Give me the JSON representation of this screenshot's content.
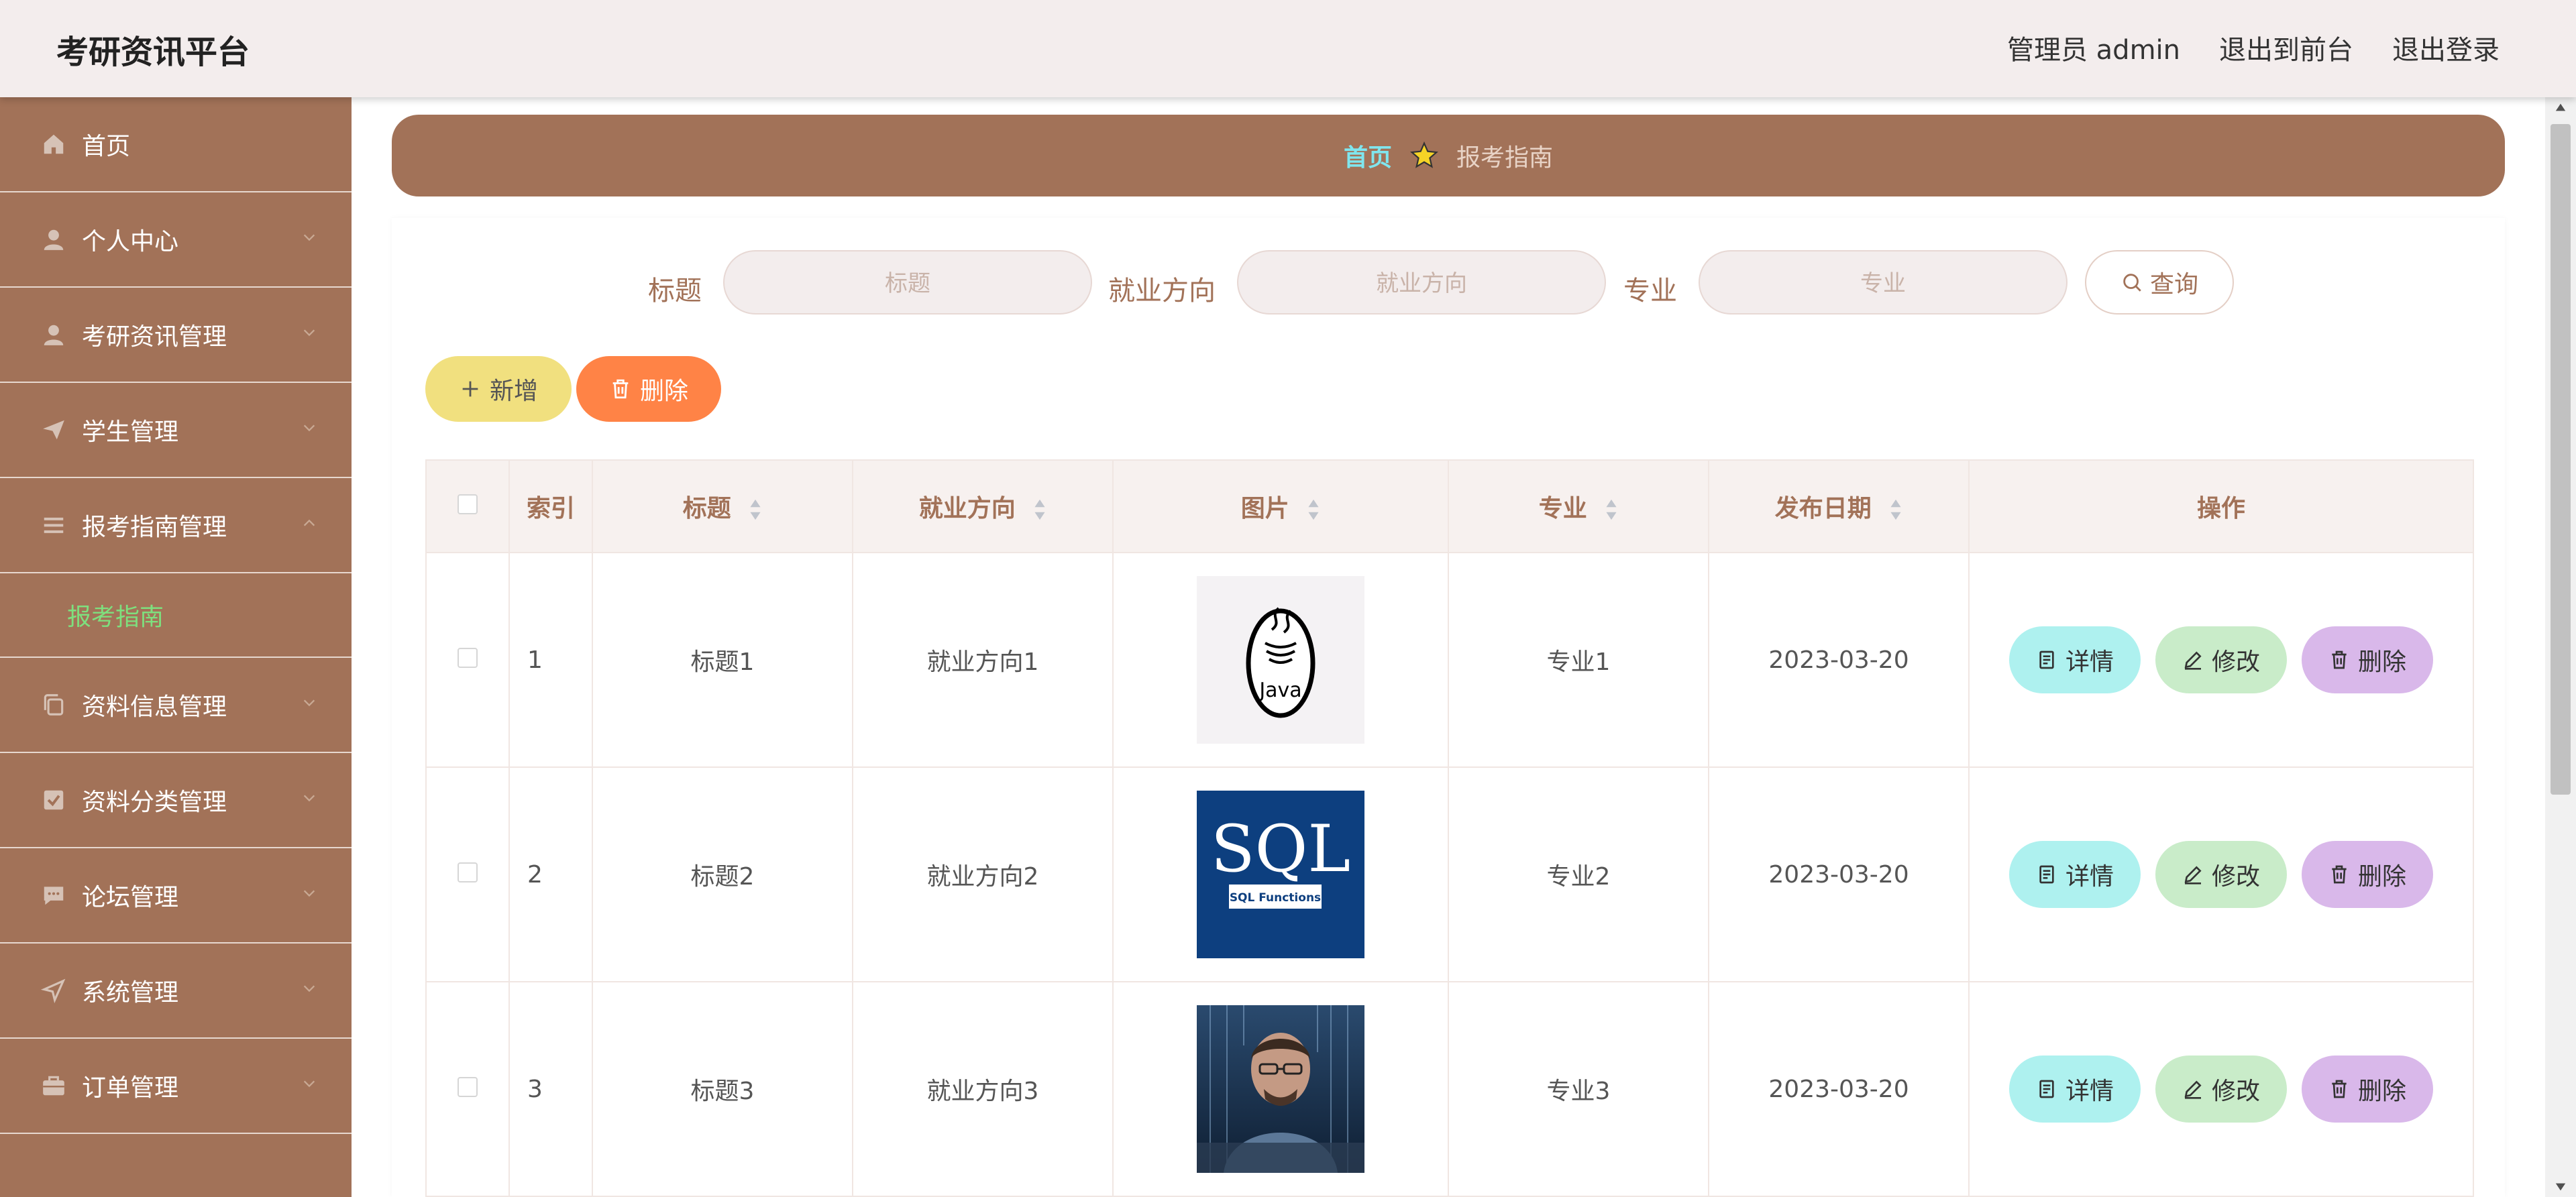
{
  "app": {
    "title": "考研资讯平台"
  },
  "header": {
    "user_label": "管理员 admin",
    "to_front": "退出到前台",
    "logout": "退出登录"
  },
  "sidebar": {
    "items": [
      {
        "label": "首页",
        "icon": "home-icon"
      },
      {
        "label": "个人中心",
        "icon": "user-icon"
      },
      {
        "label": "考研资讯管理",
        "icon": "user-icon"
      },
      {
        "label": "学生管理",
        "icon": "send-icon"
      },
      {
        "label": "报考指南管理",
        "icon": "menu-icon",
        "expanded": true
      },
      {
        "label": "资料信息管理",
        "icon": "copy-icon"
      },
      {
        "label": "资料分类管理",
        "icon": "checkbox-icon"
      },
      {
        "label": "论坛管理",
        "icon": "chat-icon"
      },
      {
        "label": "系统管理",
        "icon": "navigation-icon"
      },
      {
        "label": "订单管理",
        "icon": "briefcase-icon"
      }
    ],
    "sub_item": "报考指南"
  },
  "breadcrumb": {
    "home": "首页",
    "current": "报考指南"
  },
  "search": {
    "title_label": "标题",
    "title_placeholder": "标题",
    "direction_label": "就业方向",
    "direction_placeholder": "就业方向",
    "major_label": "专业",
    "major_placeholder": "专业",
    "query_button": "查询"
  },
  "actions": {
    "add": "新增",
    "delete": "删除"
  },
  "table": {
    "headers": [
      "索引",
      "标题",
      "就业方向",
      "图片",
      "专业",
      "发布日期",
      "操作"
    ],
    "rows": [
      {
        "index": "1",
        "title": "标题1",
        "direction": "就业方向1",
        "image": "java-logo",
        "major": "专业1",
        "date": "2023-03-20"
      },
      {
        "index": "2",
        "title": "标题2",
        "direction": "就业方向2",
        "image": "sql-functions-cover",
        "major": "专业2",
        "date": "2023-03-20"
      },
      {
        "index": "3",
        "title": "标题3",
        "direction": "就业方向3",
        "image": "programmer-photo",
        "major": "专业3",
        "date": "2023-03-20"
      }
    ],
    "row_actions": {
      "detail": "详情",
      "edit": "修改",
      "remove": "删除"
    },
    "image_texts": {
      "java": "Java",
      "sql": "SQL",
      "sql_sub": "SQL Functions"
    }
  },
  "colors": {
    "sidebar_bg": "#a27258",
    "breadcrumb_home": "#7fe6ee",
    "submenu_active": "#7ee07e",
    "add_button": "#f1e07f",
    "delete_button": "#ff8346",
    "detail_button": "#aef1ef",
    "edit_button": "#c9ecc9",
    "remove_button": "#d9b8ea"
  }
}
